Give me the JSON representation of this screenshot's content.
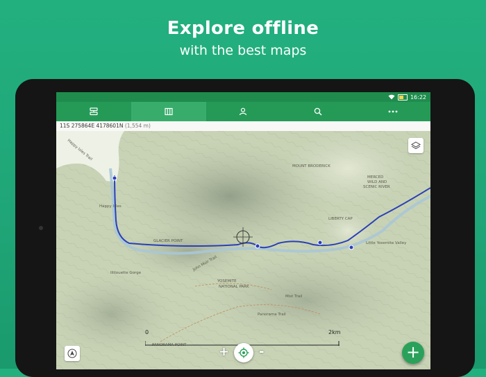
{
  "promo": {
    "title": "Explore offline",
    "subtitle": "with the best maps"
  },
  "status_bar": {
    "time": "16:22"
  },
  "toolbar": {
    "tabs": [
      {
        "name": "tracks",
        "icon": "pin-list-icon",
        "active": false
      },
      {
        "name": "maps",
        "icon": "map-icon",
        "active": true
      },
      {
        "name": "profile",
        "icon": "person-icon",
        "active": false
      },
      {
        "name": "search",
        "icon": "search-icon",
        "active": false
      },
      {
        "name": "more",
        "icon": "more-dots-icon",
        "active": false
      }
    ]
  },
  "coordinates": {
    "position": "11S 275864E 4178601N",
    "altitude": "(1,554 m)"
  },
  "map": {
    "labels": {
      "happy_isles_trail": "Happy Isles Trail",
      "happy_isles": "Happy Isles",
      "yosemite": "YOSEMITE",
      "national_park": "NATIONAL PARK",
      "merced": "MERCED",
      "wild_and": "WILD AND",
      "scenic_river": "SCENIC RIVER",
      "mount_broderick": "MOUNT BRODERICK",
      "liberty_cap": "LIBERTY CAP",
      "little_yosemite_valley": "Little Yosemite Valley",
      "glacier_point": "GLACIER POINT",
      "panorama_trail": "Panorama Trail",
      "illilouette_gorge": "Illilouette Gorge",
      "john_muir_trail": "John Muir Trail",
      "mist_trail": "Mist Trail",
      "panorama_point": "PANORAMA POINT"
    },
    "scale": {
      "start": "0",
      "end": "2km"
    }
  },
  "colors": {
    "background": "#1fa577",
    "toolbar": "#259a57",
    "toolbar_active": "#38ad6b",
    "track": "#2a3fb8",
    "river": "#a9c6d6",
    "fab": "#2aa15a"
  },
  "controls": {
    "zoom_in": "+",
    "zoom_out": "-",
    "add": "+"
  }
}
